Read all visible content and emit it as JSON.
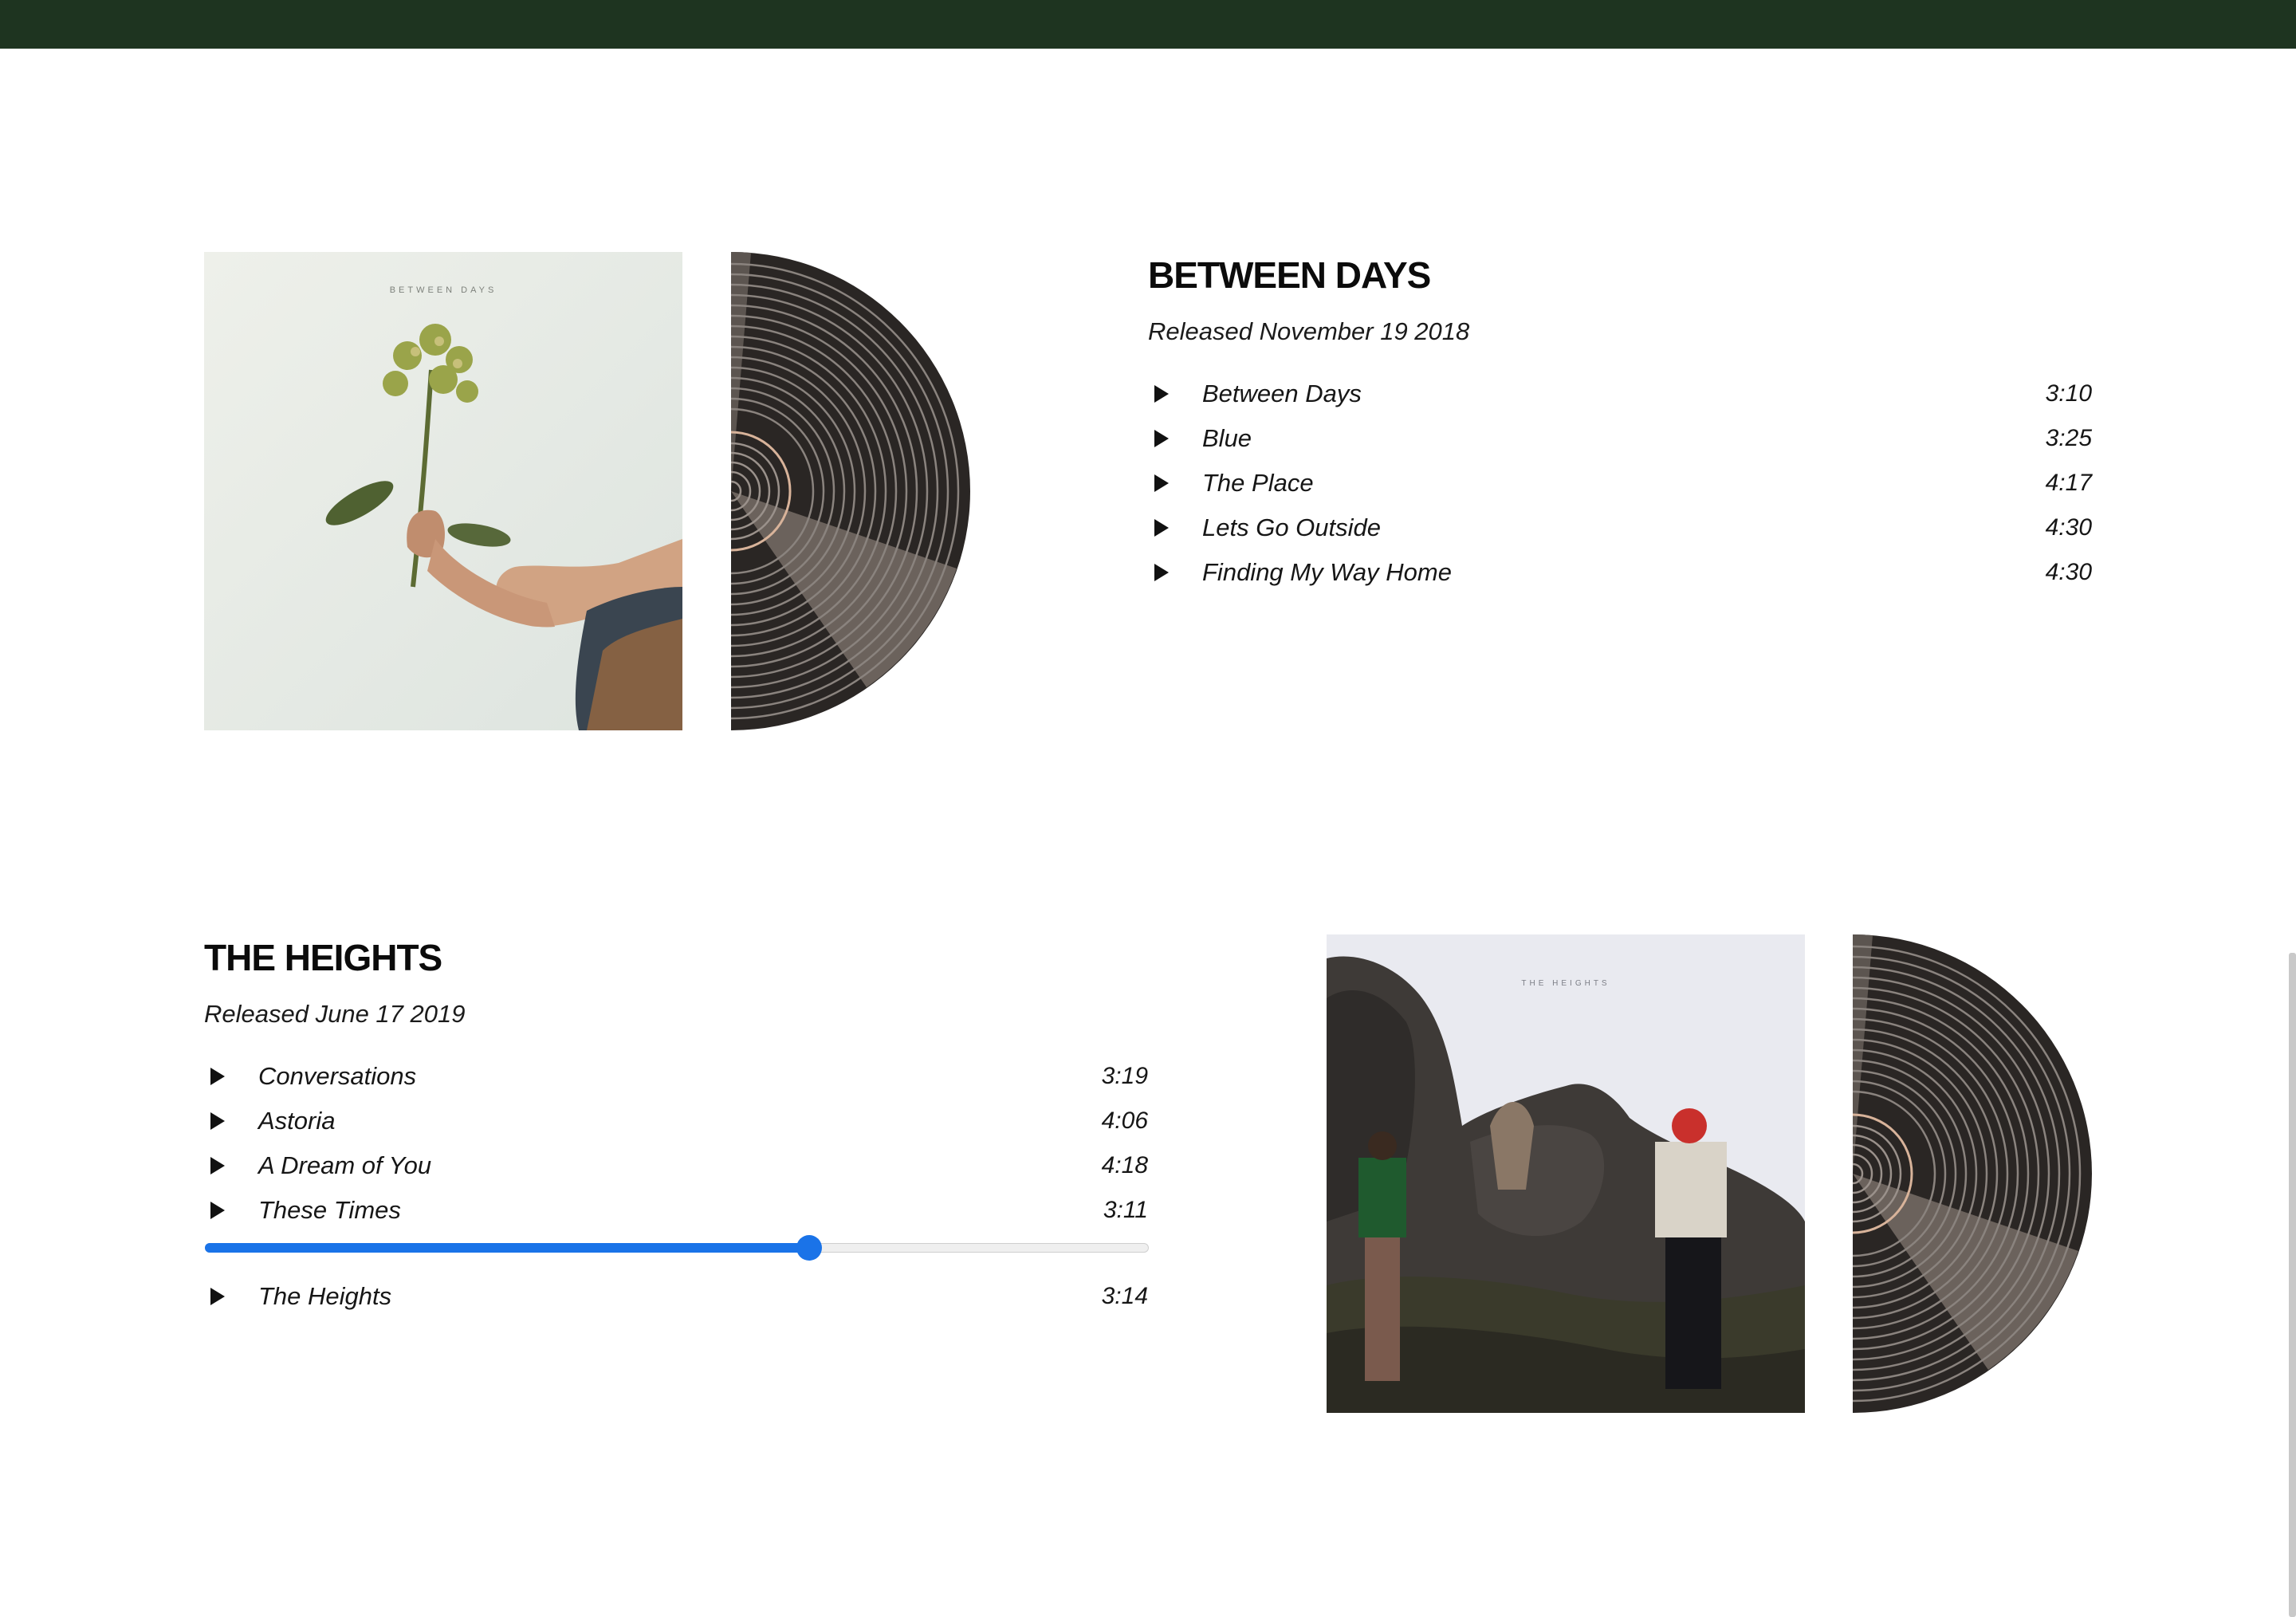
{
  "colors": {
    "topbar": "#1e3420",
    "accent": "#1a73e8",
    "vinyl": "#2a2624",
    "vinyl_label_ring": "#d8b39a"
  },
  "albums": [
    {
      "title": "BETWEEN DAYS",
      "released": "Released November 19 2018",
      "cover_text": "BETWEEN DAYS",
      "tracks": [
        {
          "name": "Between Days",
          "duration": "3:10"
        },
        {
          "name": "Blue",
          "duration": "3:25"
        },
        {
          "name": "The Place",
          "duration": "4:17"
        },
        {
          "name": "Lets Go Outside",
          "duration": "4:30"
        },
        {
          "name": "Finding My Way Home",
          "duration": "4:30"
        }
      ]
    },
    {
      "title": "THE HEIGHTS",
      "released": "Released June 17 2019",
      "cover_text": "THE HEIGHTS",
      "tracks": [
        {
          "name": "Conversations",
          "duration": "3:19"
        },
        {
          "name": "Astoria",
          "duration": "4:06"
        },
        {
          "name": "A Dream of You",
          "duration": "4:18"
        },
        {
          "name": "These Times",
          "duration": "3:11"
        },
        {
          "name": "The Heights",
          "duration": "3:14"
        }
      ],
      "player": {
        "track": "These Times",
        "progress_fraction": 0.64
      }
    }
  ],
  "icons": {
    "play": "play-icon",
    "vinyl": "vinyl-record-icon"
  }
}
